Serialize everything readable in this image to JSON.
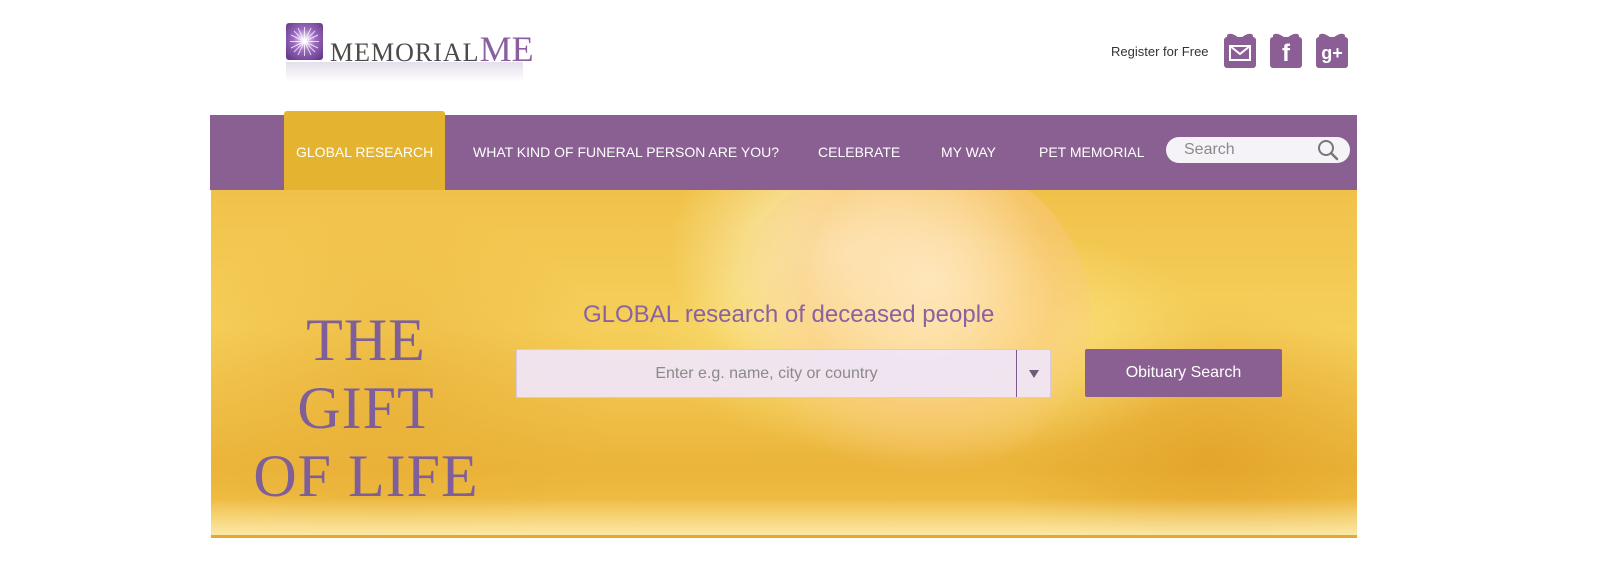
{
  "logo": {
    "text_main": "MEMORIAL",
    "text_accent": "ME"
  },
  "header": {
    "register_label": "Register for Free",
    "social": [
      {
        "icon": "mail-icon"
      },
      {
        "icon": "facebook-icon",
        "glyph": "f"
      },
      {
        "icon": "google-plus-icon",
        "glyph": "g+"
      }
    ]
  },
  "nav": {
    "items": [
      {
        "label": "GLOBAL RESEARCH",
        "active": true
      },
      {
        "label": "WHAT KIND OF FUNERAL PERSON ARE YOU?"
      },
      {
        "label": "CELEBRATE"
      },
      {
        "label": "MY WAY"
      },
      {
        "label": "PET MEMORIAL"
      }
    ],
    "search_placeholder": "Search"
  },
  "hero": {
    "tagline_line1": "THE GIFT",
    "tagline_line2": "OF LIFE",
    "research_title": "GLOBAL research of deceased people",
    "research_placeholder": "Enter e.g. name, city or country",
    "obituary_button": "Obituary Search"
  },
  "colors": {
    "brand_purple": "#8a6092",
    "accent_gold": "#e4b330",
    "text_purple": "#8a62a0"
  }
}
